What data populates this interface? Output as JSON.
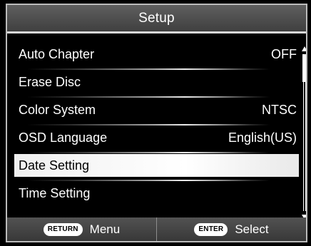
{
  "header": {
    "title": "Setup"
  },
  "menu": {
    "items": [
      {
        "label": "Auto Chapter",
        "value": "OFF"
      },
      {
        "label": "Erase Disc",
        "value": ""
      },
      {
        "label": "Color System",
        "value": "NTSC"
      },
      {
        "label": "OSD Language",
        "value": "English(US)"
      },
      {
        "label": "Date Setting",
        "value": "",
        "selected": true
      },
      {
        "label": "Time Setting",
        "value": ""
      }
    ]
  },
  "scrollbar": {
    "up_icon": "triangle-up-icon",
    "down_icon": "triangle-down-icon"
  },
  "footer": {
    "return_key": "RETURN",
    "return_label": "Menu",
    "enter_key": "ENTER",
    "enter_label": "Select"
  },
  "colors": {
    "background": "#000000",
    "selected_row": "#ffffff",
    "text": "#ffffff",
    "selected_text": "#000000"
  }
}
